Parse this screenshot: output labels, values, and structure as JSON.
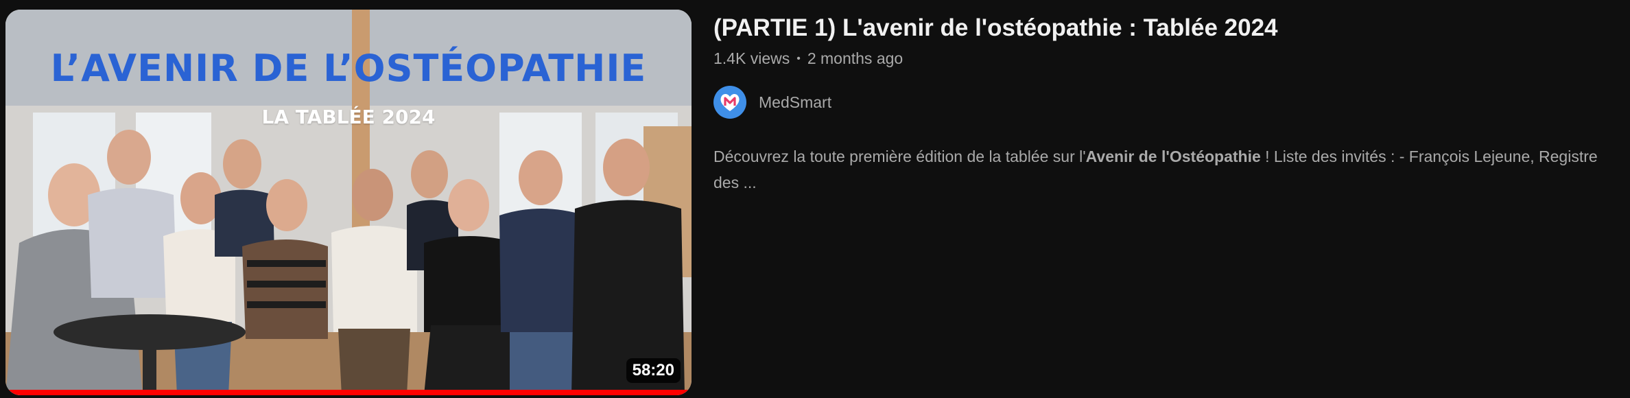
{
  "video": {
    "thumbnail": {
      "overlay_title": "L’AVENIR DE L’OSTÉOPATHIE",
      "overlay_subtitle": "LA TABLÉE 2024",
      "duration": "58:20",
      "watch_progress": 1.0
    },
    "title": "(PARTIE 1) L'avenir de l'ostéopathie : Tablée 2024",
    "views": "1.4K views",
    "separator": "•",
    "published": "2 months ago",
    "channel": {
      "name": "MedSmart",
      "avatar_icon": "heart-m-logo"
    },
    "description": {
      "before": "Découvrez la toute première édition de la tablée sur l'",
      "bold": "Avenir de l'Ostéopathie",
      "after": " ! Liste des invités : - François Lejeune, Registre des ..."
    }
  },
  "colors": {
    "background": "#0f0f0f",
    "title": "#f1f1f1",
    "secondary_text": "#aaaaaa",
    "progress": "#ff0000",
    "overlay_title": "#2a63d4",
    "avatar_bg": "#3f8fe8"
  }
}
